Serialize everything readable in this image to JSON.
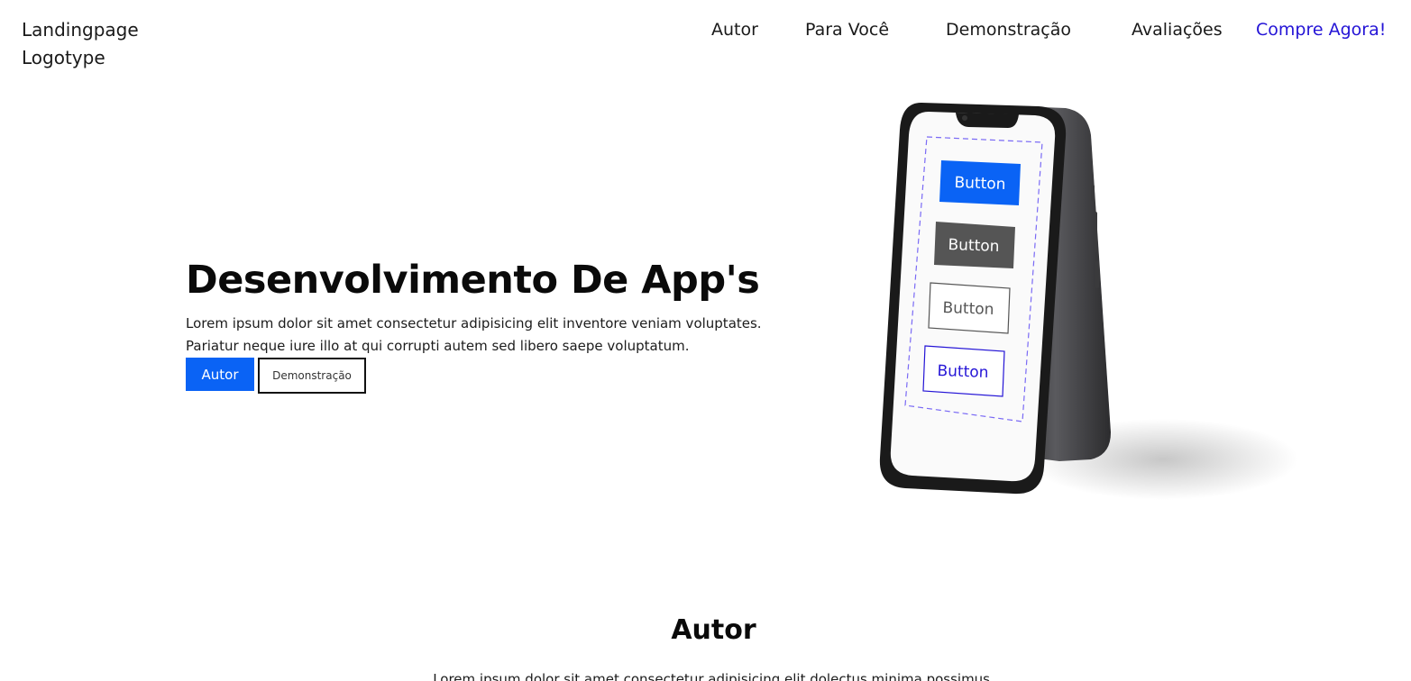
{
  "header": {
    "logo_line1": "Landingpage",
    "logo_line2": "Logotype",
    "nav": {
      "autor": "Autor",
      "para_voce": "Para Você",
      "demonstracao": "Demonstração",
      "avaliacoes": "Avaliações",
      "compre": "Compre Agora!"
    }
  },
  "hero": {
    "title": "Desenvolvimento De App's",
    "description": "Lorem ipsum dolor sit amet consectetur adipisicing elit inventore veniam voluptates. Pariatur neque iure illo at qui corrupti autem sed libero saepe voluptatum.",
    "primary_button": "Autor",
    "secondary_button": "Demonstração"
  },
  "phone_mockup": {
    "buttons": [
      "Button",
      "Button",
      "Button",
      "Button"
    ]
  },
  "autor_section": {
    "title": "Autor",
    "text": "Lorem ipsum dolor sit amet consectetur adipisicing elit dolectus minima possimus."
  },
  "colors": {
    "accent_blue": "#0a63f5",
    "link_purple": "#2414d6",
    "dark_button": "#555555"
  }
}
